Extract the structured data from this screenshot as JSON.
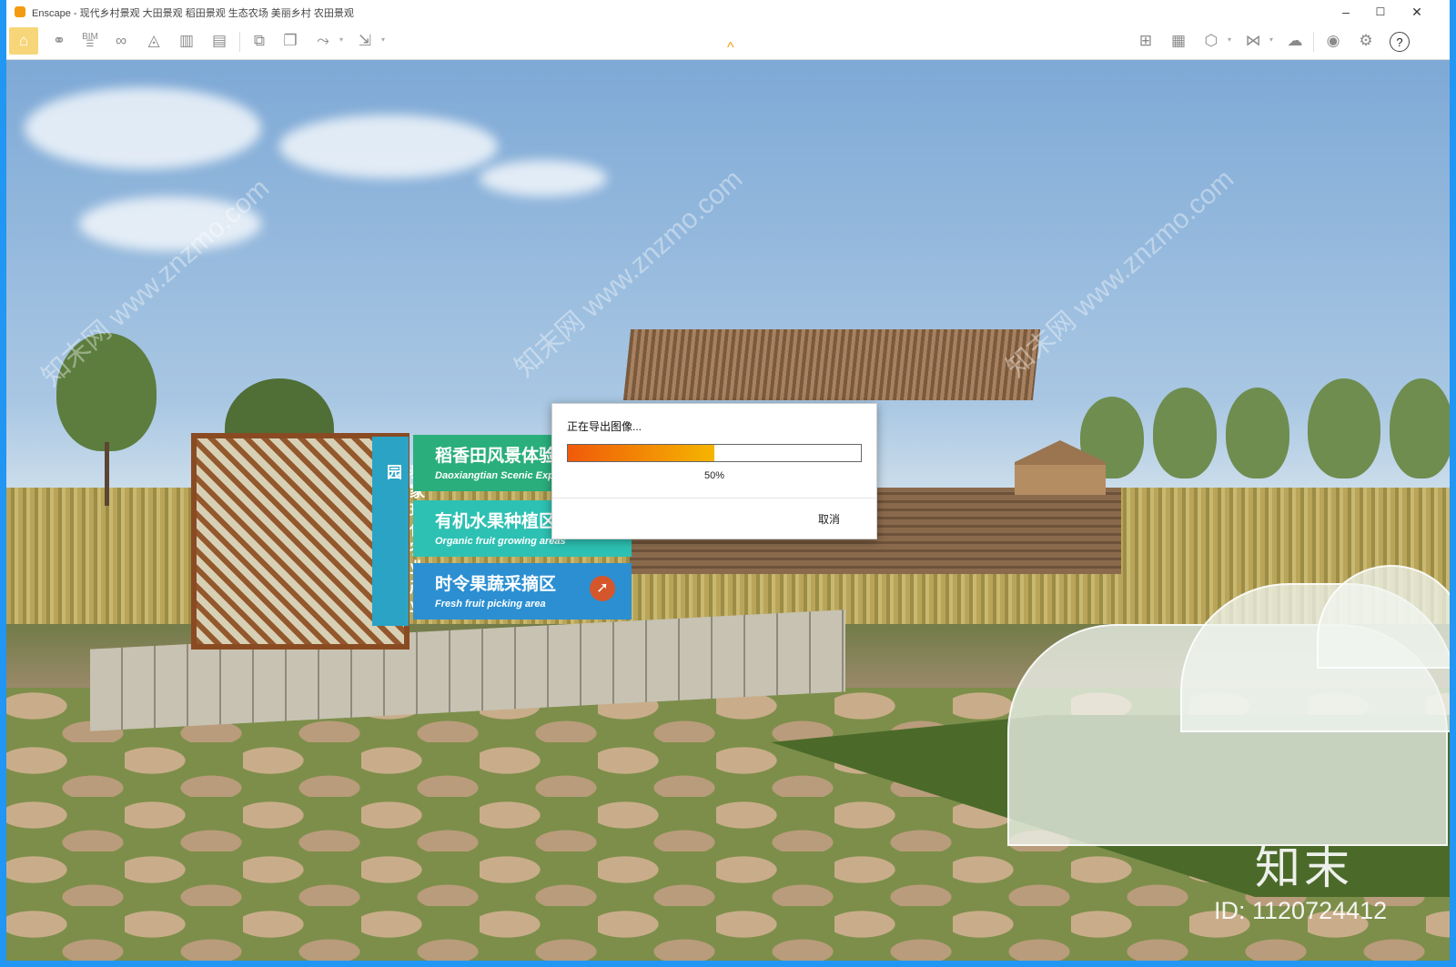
{
  "window": {
    "title": "Enscape - 现代乡村景观 大田景观 稻田景观 生态农场 美丽乡村 农田景观",
    "minimize": "–",
    "maximize": "☐",
    "close": "✕"
  },
  "toolbar": {
    "left_icons": [
      "home-icon",
      "link-icon",
      "bim-icon",
      "binoculars-icon",
      "visual-settings-icon",
      "buildings-icon",
      "layers-icon",
      "screenshot-icon",
      "batch-render-icon",
      "panorama-icon",
      "export-icon"
    ],
    "right_icons": [
      "map-icon",
      "library-icon",
      "asset-icon",
      "vr-icon",
      "upload-icon",
      "view-icon",
      "settings-icon",
      "help-icon"
    ],
    "bim_label": "BIM",
    "help_label": "?",
    "collapse_chevron": "^",
    "accent_color": "#f39c12"
  },
  "scene": {
    "sign_vertical_text": "泰家现代农业产业园",
    "signs": [
      {
        "zh": "稻香田风景体验区",
        "en": "Daoxiangtian Scenic Experien"
      },
      {
        "zh": "有机水果种植区",
        "en": "Organic fruit growing areas"
      },
      {
        "zh": "时令果蔬采摘区",
        "en": "Fresh fruit picking area"
      }
    ],
    "sign_colors": [
      "#2aae7c",
      "#2dc1b3",
      "#2b8fd2"
    ]
  },
  "dialog": {
    "title": "正在导出图像...",
    "progress_value": 0.5,
    "progress_text": "50%",
    "cancel_label": "取消"
  },
  "watermark": {
    "brand": "知末",
    "id_text": "ID: 1120724412",
    "diagonal_text": "知末网 www.znzmo.com"
  }
}
